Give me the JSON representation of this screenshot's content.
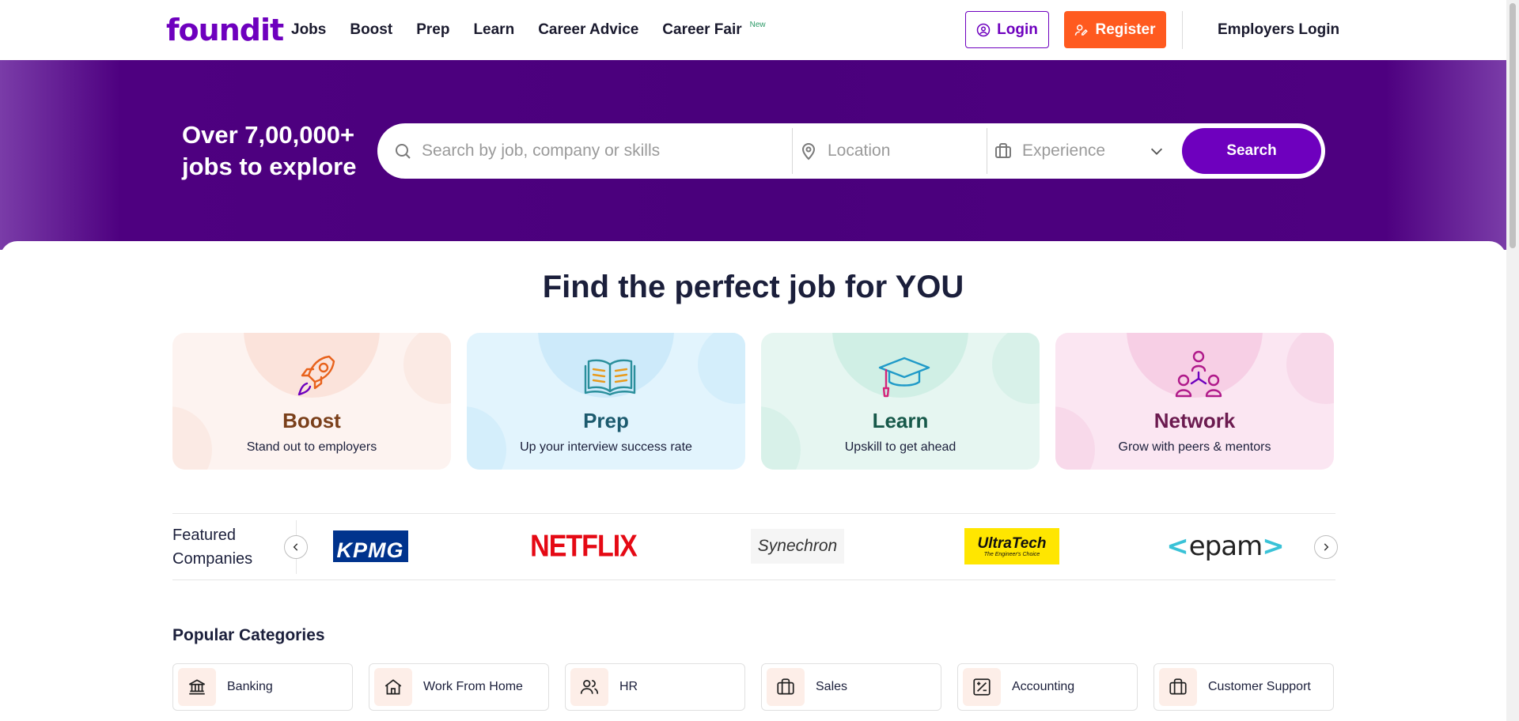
{
  "header": {
    "logo_text": "foundit",
    "nav": [
      {
        "label": "Jobs"
      },
      {
        "label": "Boost"
      },
      {
        "label": "Prep"
      },
      {
        "label": "Learn"
      },
      {
        "label": "Career Advice"
      },
      {
        "label": "Career Fair",
        "badge": "New"
      }
    ],
    "login_label": "Login",
    "register_label": "Register",
    "employers_label": "Employers Login"
  },
  "hero": {
    "title_line1": "Over 7,00,000+",
    "title_line2": "jobs to explore",
    "keyword_placeholder": "Search by job, company or skills",
    "location_placeholder": "Location",
    "experience_placeholder": "Experience",
    "search_label": "Search"
  },
  "main": {
    "title": "Find the perfect job for YOU",
    "cards": [
      {
        "title": "Boost",
        "subtitle": "Stand out to employers"
      },
      {
        "title": "Prep",
        "subtitle": "Up your interview success rate"
      },
      {
        "title": "Learn",
        "subtitle": "Upskill to get ahead"
      },
      {
        "title": "Network",
        "subtitle": "Grow with peers & mentors"
      }
    ],
    "featured": {
      "label": "Featured Companies",
      "companies": [
        "KPMG",
        "NETFLIX",
        "Synechron",
        "UltraTech",
        "epam"
      ],
      "ultratech_tagline": "The Engineer's Choice"
    },
    "popular_title": "Popular Categories",
    "categories": [
      {
        "label": "Banking",
        "icon": "bank-icon"
      },
      {
        "label": "Work From Home",
        "icon": "home-icon"
      },
      {
        "label": "HR",
        "icon": "people-icon"
      },
      {
        "label": "Sales",
        "icon": "briefcase-icon"
      },
      {
        "label": "Accounting",
        "icon": "calculator-icon"
      },
      {
        "label": "Customer Support",
        "icon": "briefcase-icon"
      }
    ]
  },
  "colors": {
    "brand_purple": "#6e00be",
    "hero_purple": "#4a007c",
    "register_orange": "#ff5a1f"
  }
}
